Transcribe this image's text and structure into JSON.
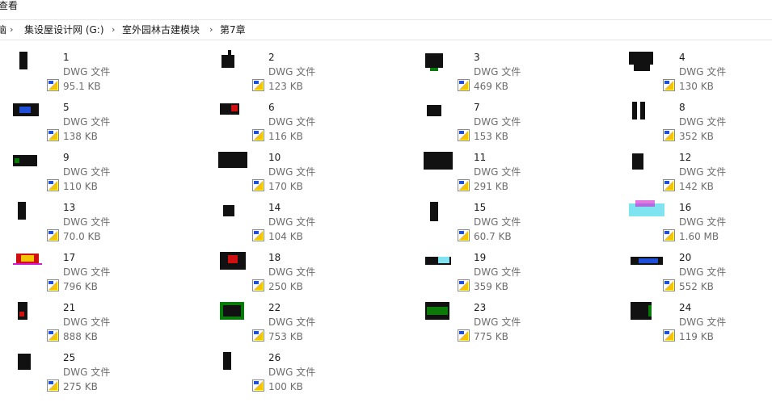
{
  "menubar": {
    "view_label": "查看"
  },
  "address": {
    "crumbs": [
      "脑",
      "集设屋设计网 (G:)",
      "室外园林古建模块",
      "第7章"
    ],
    "separator": "›"
  },
  "files": [
    {
      "name": "1",
      "type": "DWG 文件",
      "size": "95.1 KB",
      "icon": "dwg-thumb-icon"
    },
    {
      "name": "2",
      "type": "DWG 文件",
      "size": "123 KB",
      "icon": "dwg-thumb-icon"
    },
    {
      "name": "3",
      "type": "DWG 文件",
      "size": "469 KB",
      "icon": "dwg-thumb-icon"
    },
    {
      "name": "4",
      "type": "DWG 文件",
      "size": "130 KB",
      "icon": "dwg-thumb-icon"
    },
    {
      "name": "5",
      "type": "DWG 文件",
      "size": "138 KB",
      "icon": "dwg-thumb-icon"
    },
    {
      "name": "6",
      "type": "DWG 文件",
      "size": "116 KB",
      "icon": "dwg-thumb-icon"
    },
    {
      "name": "7",
      "type": "DWG 文件",
      "size": "153 KB",
      "icon": "dwg-thumb-icon"
    },
    {
      "name": "8",
      "type": "DWG 文件",
      "size": "352 KB",
      "icon": "dwg-thumb-icon"
    },
    {
      "name": "9",
      "type": "DWG 文件",
      "size": "110 KB",
      "icon": "dwg-thumb-icon"
    },
    {
      "name": "10",
      "type": "DWG 文件",
      "size": "170 KB",
      "icon": "dwg-thumb-icon"
    },
    {
      "name": "11",
      "type": "DWG 文件",
      "size": "291 KB",
      "icon": "dwg-thumb-icon"
    },
    {
      "name": "12",
      "type": "DWG 文件",
      "size": "142 KB",
      "icon": "dwg-thumb-icon"
    },
    {
      "name": "13",
      "type": "DWG 文件",
      "size": "70.0 KB",
      "icon": "dwg-thumb-icon"
    },
    {
      "name": "14",
      "type": "DWG 文件",
      "size": "104 KB",
      "icon": "dwg-thumb-icon"
    },
    {
      "name": "15",
      "type": "DWG 文件",
      "size": "60.7 KB",
      "icon": "dwg-thumb-icon"
    },
    {
      "name": "16",
      "type": "DWG 文件",
      "size": "1.60 MB",
      "icon": "dwg-thumb-icon"
    },
    {
      "name": "17",
      "type": "DWG 文件",
      "size": "796 KB",
      "icon": "dwg-thumb-icon"
    },
    {
      "name": "18",
      "type": "DWG 文件",
      "size": "250 KB",
      "icon": "dwg-thumb-icon"
    },
    {
      "name": "19",
      "type": "DWG 文件",
      "size": "359 KB",
      "icon": "dwg-thumb-icon"
    },
    {
      "name": "20",
      "type": "DWG 文件",
      "size": "552 KB",
      "icon": "dwg-thumb-icon"
    },
    {
      "name": "21",
      "type": "DWG 文件",
      "size": "888 KB",
      "icon": "dwg-thumb-icon"
    },
    {
      "name": "22",
      "type": "DWG 文件",
      "size": "753 KB",
      "icon": "dwg-thumb-icon"
    },
    {
      "name": "23",
      "type": "DWG 文件",
      "size": "775 KB",
      "icon": "dwg-thumb-icon"
    },
    {
      "name": "24",
      "type": "DWG 文件",
      "size": "119 KB",
      "icon": "dwg-thumb-icon"
    },
    {
      "name": "25",
      "type": "DWG 文件",
      "size": "275 KB",
      "icon": "dwg-thumb-icon"
    },
    {
      "name": "26",
      "type": "DWG 文件",
      "size": "100 KB",
      "icon": "dwg-thumb-icon"
    }
  ],
  "colors": {
    "thumb_black": "#111111",
    "thumb_green": "#0a7a0a",
    "thumb_cyan": "#7fe3f0",
    "thumb_magenta": "#d21bd2",
    "thumb_blue": "#1f4fd6",
    "thumb_yellow": "#f5c400",
    "thumb_red": "#d01010"
  }
}
